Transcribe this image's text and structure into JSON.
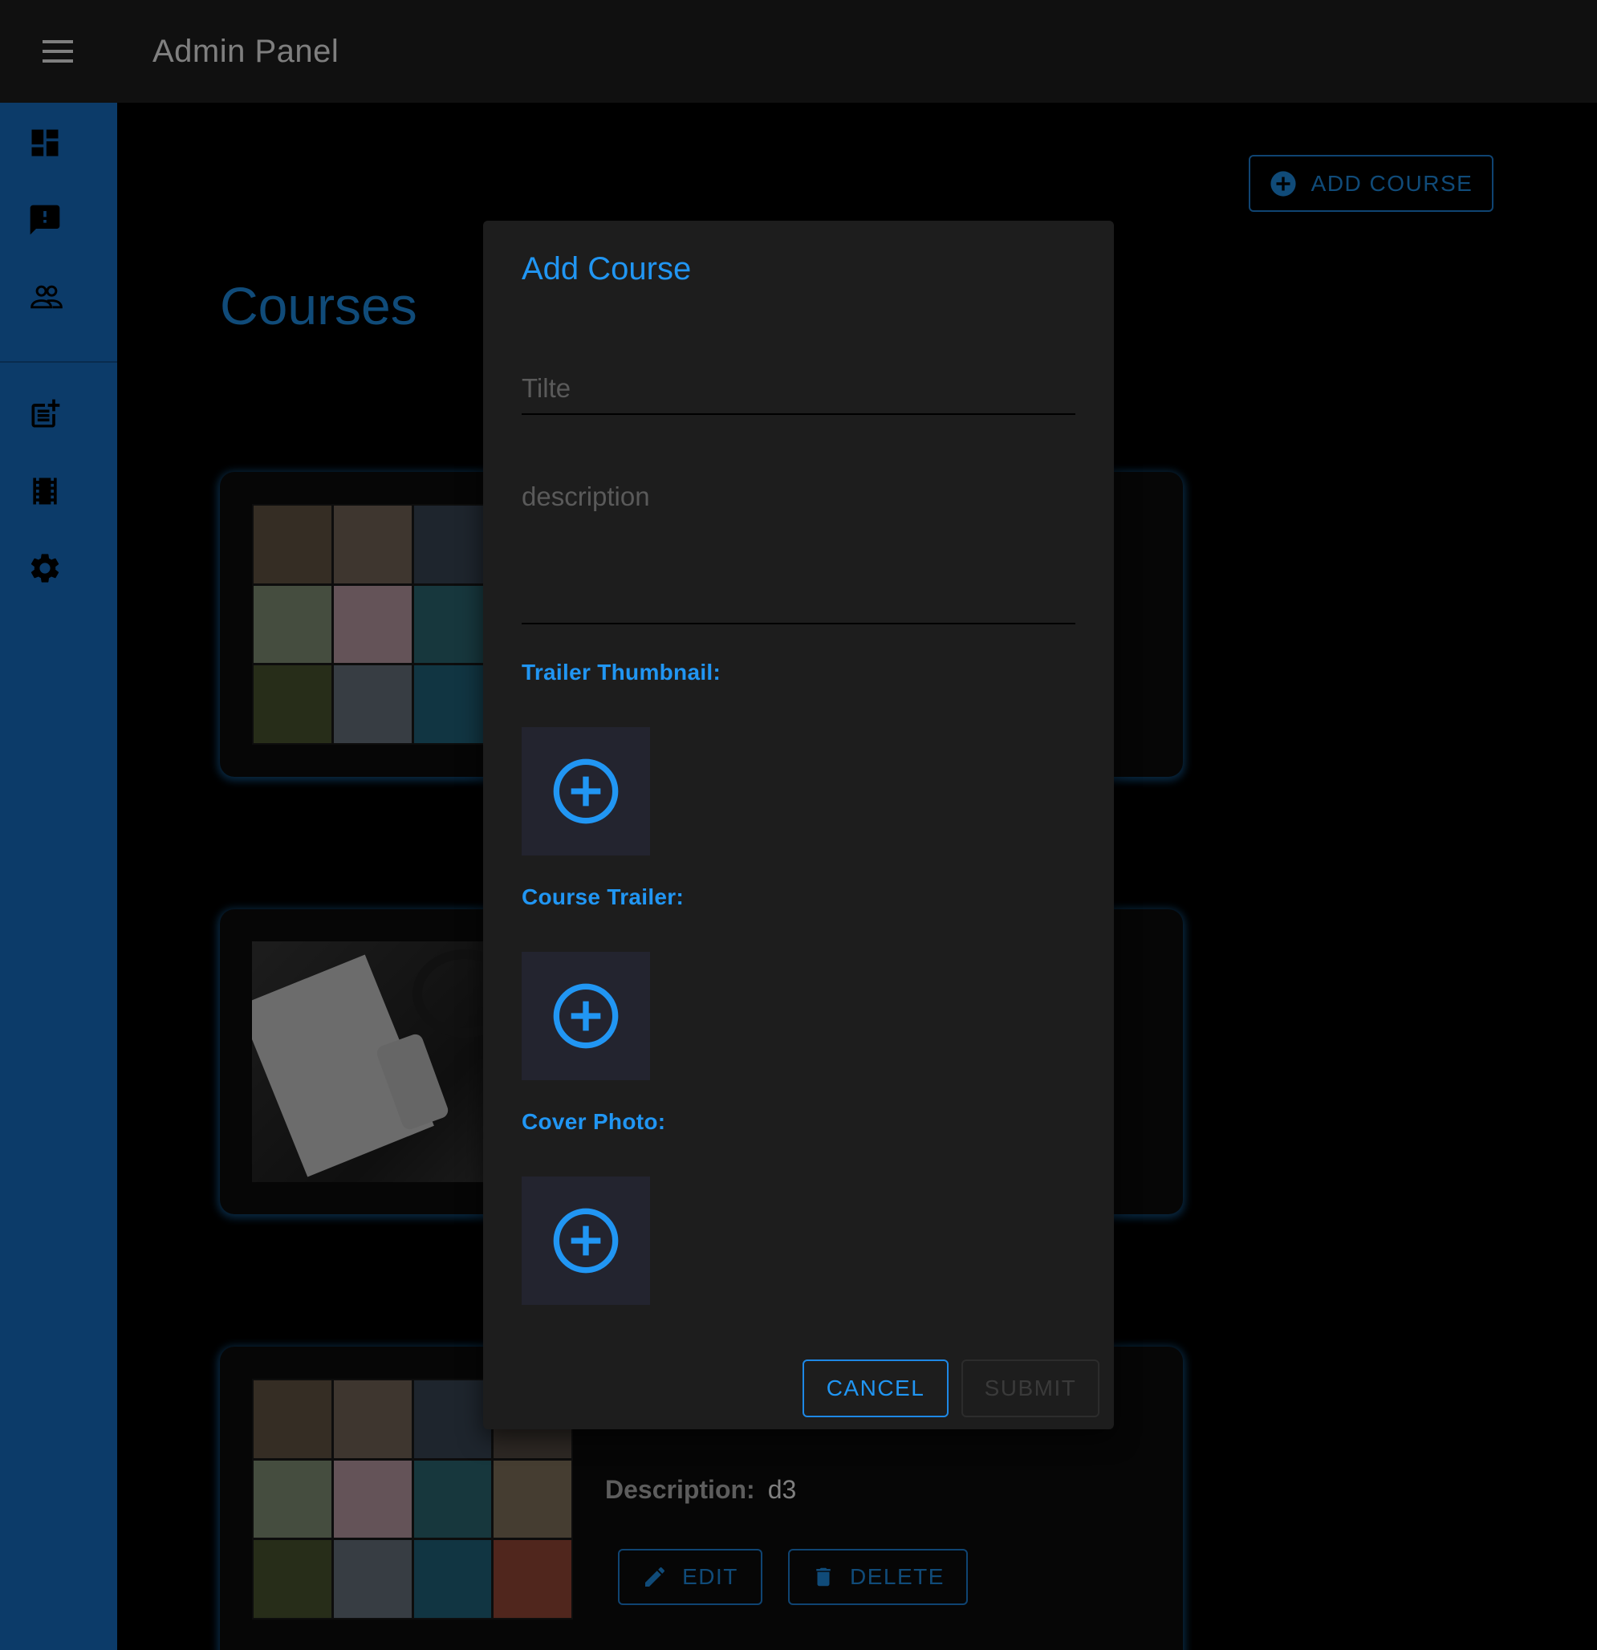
{
  "appbar": {
    "title": "Admin Panel",
    "menu_icon": "menu-icon"
  },
  "sidebar": {
    "items": [
      {
        "name": "dashboard",
        "icon": "dashboard-icon"
      },
      {
        "name": "feedback",
        "icon": "feedback-icon"
      },
      {
        "name": "users",
        "icon": "people-icon"
      },
      {
        "name": "add-post",
        "icon": "post-add-icon"
      },
      {
        "name": "courses",
        "icon": "movie-icon"
      },
      {
        "name": "settings",
        "icon": "gear-icon"
      }
    ]
  },
  "main": {
    "add_course_label": "ADD COURSE",
    "page_title": "Courses",
    "cards": [
      {
        "description_label": "Description:",
        "description": "d3"
      }
    ],
    "edit_label": "EDIT",
    "delete_label": "DELETE"
  },
  "dialog": {
    "title": "Add Course",
    "title_placeholder": "Tilte",
    "description_placeholder": "description",
    "trailer_thumbnail_label": "Trailer Thumbnail:",
    "course_trailer_label": "Course Trailer:",
    "cover_photo_label": "Cover Photo:",
    "cancel_label": "CANCEL",
    "submit_label": "SUBMIT"
  },
  "colors": {
    "accent": "#2196f3",
    "sidebar": "#1976d2",
    "appbar": "#212121",
    "dialog": "#1d1d1d"
  }
}
